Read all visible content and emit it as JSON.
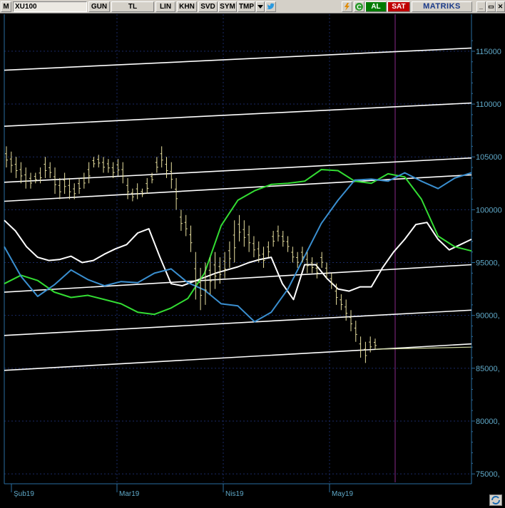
{
  "toolbar": {
    "m_label": "M",
    "symbol": "XU100",
    "period": "GUN",
    "currency": "TL",
    "scale": "LIN",
    "khn": "KHN",
    "svd": "SVD",
    "sym": "SYM",
    "tmp": "TMP",
    "al": "AL",
    "sat": "SAT",
    "brand": "MATRIKS",
    "refresh_icon": "c-circle-icon",
    "bolt_icon": "lightning-icon",
    "twitter_icon": "bird-icon"
  },
  "colors": {
    "background": "#000000",
    "price_bars": "#e8e0a0",
    "white_line": "#ffffff",
    "green_line": "#33dd33",
    "blue_line": "#3a8fd0",
    "axis": "#2a6ea0",
    "grid": "#1a2a66"
  },
  "chart_data": {
    "type": "line",
    "symbol": "XU100",
    "y_axis_labels": [
      "115000",
      "110000",
      "105000",
      "100000",
      "95000,",
      "90000,",
      "85000,",
      "80000,",
      "75000,"
    ],
    "ylim": [
      74000,
      117000
    ],
    "x_axis_labels": [
      "Şub19",
      "Mar19",
      "Nis19",
      "May19"
    ],
    "grid": true,
    "price_bars": [
      {
        "h": 106000,
        "l": 104000
      },
      {
        "h": 105500,
        "l": 103500
      },
      {
        "h": 105000,
        "l": 103000
      },
      {
        "h": 104500,
        "l": 102500
      },
      {
        "h": 104000,
        "l": 102000
      },
      {
        "h": 103500,
        "l": 102000
      },
      {
        "h": 103500,
        "l": 102500
      },
      {
        "h": 104000,
        "l": 102500
      },
      {
        "h": 105000,
        "l": 103000
      },
      {
        "h": 104500,
        "l": 103000
      },
      {
        "h": 104000,
        "l": 101500
      },
      {
        "h": 103000,
        "l": 101000
      },
      {
        "h": 103500,
        "l": 101500
      },
      {
        "h": 103000,
        "l": 101000
      },
      {
        "h": 102500,
        "l": 101000
      },
      {
        "h": 103000,
        "l": 101500
      },
      {
        "h": 103500,
        "l": 102000
      },
      {
        "h": 104500,
        "l": 102500
      },
      {
        "h": 105000,
        "l": 104000
      },
      {
        "h": 105200,
        "l": 104000
      },
      {
        "h": 105000,
        "l": 103500
      },
      {
        "h": 104800,
        "l": 103500
      },
      {
        "h": 104500,
        "l": 103000
      },
      {
        "h": 104800,
        "l": 103200
      },
      {
        "h": 104500,
        "l": 102500
      },
      {
        "h": 103000,
        "l": 101000
      },
      {
        "h": 102000,
        "l": 100800
      },
      {
        "h": 102500,
        "l": 101000
      },
      {
        "h": 102000,
        "l": 101200
      },
      {
        "h": 103000,
        "l": 101500
      },
      {
        "h": 103500,
        "l": 102500
      },
      {
        "h": 105000,
        "l": 103500
      },
      {
        "h": 106000,
        "l": 104000
      },
      {
        "h": 105000,
        "l": 103000
      },
      {
        "h": 104500,
        "l": 102000
      },
      {
        "h": 103000,
        "l": 100000
      },
      {
        "h": 100000,
        "l": 98000
      },
      {
        "h": 99500,
        "l": 97500
      },
      {
        "h": 98500,
        "l": 96000
      },
      {
        "h": 96000,
        "l": 91500
      },
      {
        "h": 94500,
        "l": 90500
      },
      {
        "h": 95000,
        "l": 91000
      },
      {
        "h": 95500,
        "l": 92000
      },
      {
        "h": 96000,
        "l": 92500
      },
      {
        "h": 95500,
        "l": 93000
      },
      {
        "h": 96000,
        "l": 93500
      },
      {
        "h": 97000,
        "l": 94500
      },
      {
        "h": 99000,
        "l": 95000
      },
      {
        "h": 99500,
        "l": 97000
      },
      {
        "h": 99000,
        "l": 96500
      },
      {
        "h": 98500,
        "l": 96000
      },
      {
        "h": 97500,
        "l": 95500
      },
      {
        "h": 97000,
        "l": 95000
      },
      {
        "h": 96500,
        "l": 94500
      },
      {
        "h": 97000,
        "l": 95500
      },
      {
        "h": 98000,
        "l": 96500
      },
      {
        "h": 98500,
        "l": 97000
      },
      {
        "h": 98000,
        "l": 96500
      },
      {
        "h": 97500,
        "l": 96000
      },
      {
        "h": 96500,
        "l": 95000
      },
      {
        "h": 96000,
        "l": 94500
      },
      {
        "h": 96500,
        "l": 95000
      },
      {
        "h": 96000,
        "l": 94000
      },
      {
        "h": 95500,
        "l": 94000
      },
      {
        "h": 95000,
        "l": 93500
      },
      {
        "h": 96000,
        "l": 94500
      },
      {
        "h": 95000,
        "l": 93500
      },
      {
        "h": 94000,
        "l": 92500
      },
      {
        "h": 93000,
        "l": 91000
      },
      {
        "h": 92000,
        "l": 90500
      },
      {
        "h": 91500,
        "l": 89500
      },
      {
        "h": 90500,
        "l": 88500
      },
      {
        "h": 89500,
        "l": 87500
      },
      {
        "h": 88000,
        "l": 86000
      },
      {
        "h": 87500,
        "l": 85500
      },
      {
        "h": 88000,
        "l": 86500
      },
      {
        "h": 87800,
        "l": 86800
      }
    ],
    "series": [
      {
        "color": "white",
        "values": [
          99000,
          98000,
          96500,
          95500,
          95200,
          95300,
          95600,
          95000,
          95200,
          95800,
          96300,
          96700,
          97800,
          98200,
          95500,
          93000,
          92800,
          93200,
          93600,
          94000,
          94300,
          94600,
          95000,
          95300,
          95500,
          93000,
          91500,
          94800,
          94800,
          93500,
          92500,
          92300,
          92700,
          92700,
          94500,
          96000,
          97200,
          98600,
          98800,
          97200,
          96200,
          96700,
          97200
        ]
      },
      {
        "color": "green",
        "values": [
          93000,
          93800,
          93300,
          92200,
          91700,
          91900,
          91500,
          91100,
          90300,
          90100,
          90700,
          91600,
          94000,
          98500,
          100900,
          101800,
          102400,
          102500,
          102700,
          103800,
          103700,
          102700,
          102500,
          103400,
          103100,
          101000,
          97500,
          96500,
          96100
        ]
      },
      {
        "color": "blue",
        "values": [
          96500,
          93700,
          91800,
          92900,
          94300,
          93400,
          92800,
          93200,
          93100,
          94000,
          94400,
          93100,
          92400,
          91100,
          90900,
          89400,
          90300,
          92500,
          95600,
          98700,
          100900,
          102800,
          102900,
          102700,
          103500,
          102700,
          102000,
          103000,
          103500
        ]
      }
    ],
    "trend_lines": [
      {
        "x0": 0,
        "y0": 113200,
        "x1": 1,
        "y1": 115300
      },
      {
        "x0": 0,
        "y0": 107900,
        "x1": 1,
        "y1": 110100
      },
      {
        "x0": 0,
        "y0": 102600,
        "x1": 1,
        "y1": 104900
      },
      {
        "x0": 0,
        "y0": 100800,
        "x1": 1,
        "y1": 103300
      },
      {
        "x0": 0,
        "y0": 92200,
        "x1": 1,
        "y1": 94800
      },
      {
        "x0": 0,
        "y0": 88100,
        "x1": 1,
        "y1": 90500
      },
      {
        "x0": 0,
        "y0": 84800,
        "x1": 1,
        "y1": 87300
      }
    ]
  }
}
